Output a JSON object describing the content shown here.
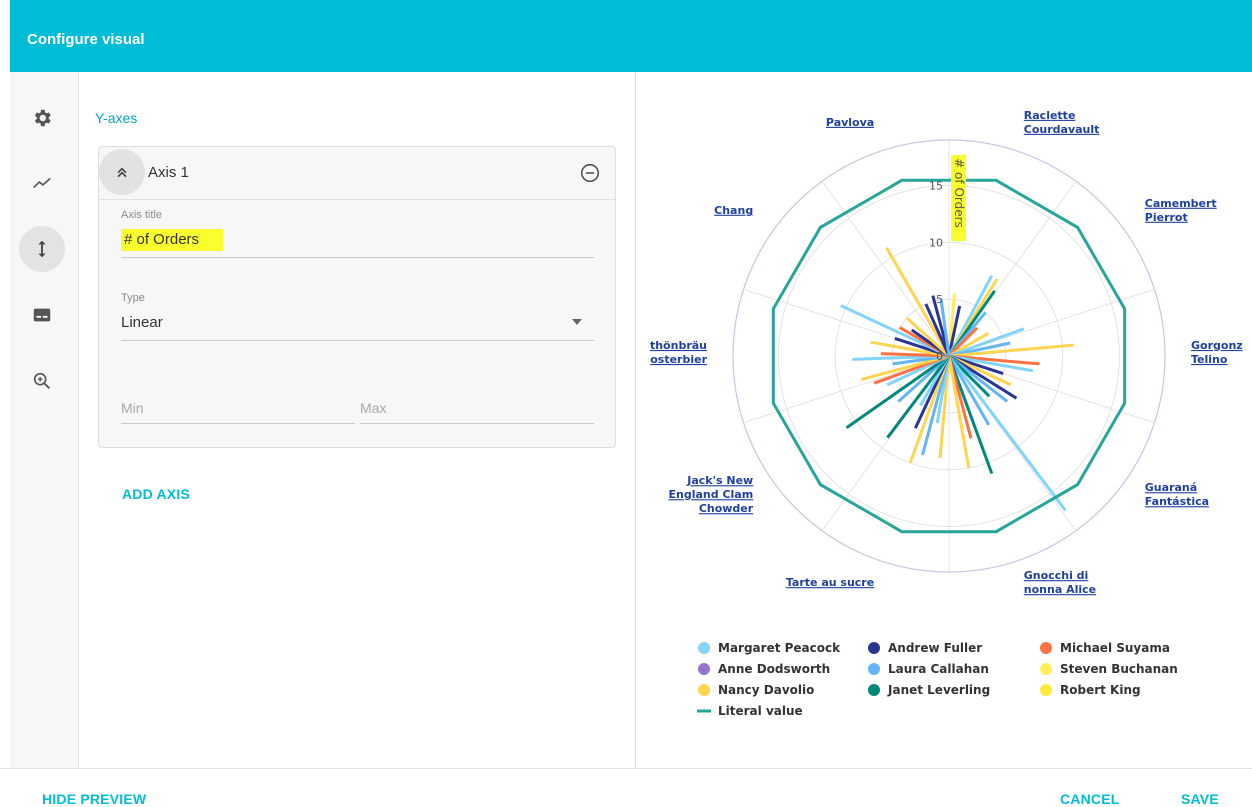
{
  "header": {
    "title": "Configure visual"
  },
  "sidebar_icons": [
    {
      "name": "gear-icon",
      "active": false
    },
    {
      "name": "line-chart-icon",
      "active": false
    },
    {
      "name": "vertical-arrows-icon",
      "active": true
    },
    {
      "name": "legend-icon",
      "active": false
    },
    {
      "name": "zoom-in-icon",
      "active": false
    }
  ],
  "settings": {
    "section_title": "Y-axes",
    "axis": {
      "name": "Axis 1",
      "title_label": "Axis title",
      "title_value": "# of Orders",
      "type_label": "Type",
      "type_value": "Linear",
      "min_placeholder": "Min",
      "max_placeholder": "Max"
    },
    "add_axis_label": "ADD AXIS"
  },
  "footer": {
    "hide_preview": "HIDE PREVIEW",
    "cancel": "CANCEL",
    "save": "SAVE"
  },
  "colors": {
    "accent": "#00bcd4",
    "highlight": "#f8ff2c",
    "literal_line": "#26a69a"
  },
  "chart_data": {
    "type": "polar",
    "axis_title": "# of Orders",
    "rmax": 19,
    "ticks": [
      0,
      5,
      10,
      15
    ],
    "categories": [
      [
        "Raclette",
        "Courdavault"
      ],
      [
        "Camembert",
        "Pierrot"
      ],
      [
        "Gorgonz",
        "Telino"
      ],
      [
        "Guaraná",
        "Fantástica"
      ],
      [
        "Gnocchi di",
        "nonna Alice"
      ],
      [
        "Tarte au sucre"
      ],
      [
        "Jack's New",
        "England Clam",
        "Chowder"
      ],
      [
        "thönbräu",
        "osterbier"
      ],
      [
        "Chang"
      ],
      [
        "Pavlova"
      ]
    ],
    "literal_value": 16,
    "series": [
      {
        "name": "Margaret Peacock",
        "color": "#81d4fa"
      },
      {
        "name": "Andrew Fuller",
        "color": "#283593"
      },
      {
        "name": "Michael Suyama",
        "color": "#ff7043"
      },
      {
        "name": "Anne Dodsworth",
        "color": "#9575cd"
      },
      {
        "name": "Laura Callahan",
        "color": "#64b5f6"
      },
      {
        "name": "Steven Buchanan",
        "color": "#ffee58"
      },
      {
        "name": "Nancy Davolio",
        "color": "#ffd54f"
      },
      {
        "name": "Janet Leverling",
        "color": "#00897b"
      },
      {
        "name": "Robert King",
        "color": "#ffeb3b"
      }
    ],
    "literal_series": {
      "name": "Literal value",
      "color": "#26a69a"
    },
    "rays": [
      {
        "angle": 5,
        "value": 5.5,
        "series": 5
      },
      {
        "angle": 12,
        "value": 4.5,
        "series": 1
      },
      {
        "angle": 28,
        "value": 8,
        "series": 0
      },
      {
        "angle": 32,
        "value": 8,
        "series": 6
      },
      {
        "angle": 35,
        "value": 7,
        "series": 7
      },
      {
        "angle": 40,
        "value": 5,
        "series": 4
      },
      {
        "angle": 45,
        "value": 3.5,
        "series": 2
      },
      {
        "angle": 60,
        "value": 4,
        "series": 6
      },
      {
        "angle": 70,
        "value": 7,
        "series": 0
      },
      {
        "angle": 78,
        "value": 5.5,
        "series": 4
      },
      {
        "angle": 85,
        "value": 11,
        "series": 6
      },
      {
        "angle": 95,
        "value": 8,
        "series": 2
      },
      {
        "angle": 100,
        "value": 7.5,
        "series": 0
      },
      {
        "angle": 108,
        "value": 5,
        "series": 1
      },
      {
        "angle": 115,
        "value": 6,
        "series": 6
      },
      {
        "angle": 122,
        "value": 7,
        "series": 1
      },
      {
        "angle": 128,
        "value": 6.5,
        "series": 4
      },
      {
        "angle": 135,
        "value": 5,
        "series": 7
      },
      {
        "angle": 143,
        "value": 17,
        "series": 0
      },
      {
        "angle": 150,
        "value": 7,
        "series": 4
      },
      {
        "angle": 160,
        "value": 11,
        "series": 7
      },
      {
        "angle": 165,
        "value": 7.5,
        "series": 2
      },
      {
        "angle": 170,
        "value": 10,
        "series": 6
      },
      {
        "angle": 185,
        "value": 9,
        "series": 6
      },
      {
        "angle": 190,
        "value": 6,
        "series": 0
      },
      {
        "angle": 195,
        "value": 9,
        "series": 4
      },
      {
        "angle": 200,
        "value": 10,
        "series": 6
      },
      {
        "angle": 205,
        "value": 7,
        "series": 1
      },
      {
        "angle": 210,
        "value": 5,
        "series": 0
      },
      {
        "angle": 217,
        "value": 9,
        "series": 7
      },
      {
        "angle": 228,
        "value": 6,
        "series": 4
      },
      {
        "angle": 235,
        "value": 11,
        "series": 7
      },
      {
        "angle": 245,
        "value": 6,
        "series": 0
      },
      {
        "angle": 250,
        "value": 7,
        "series": 2
      },
      {
        "angle": 255,
        "value": 8,
        "series": 6
      },
      {
        "angle": 262,
        "value": 5,
        "series": 4
      },
      {
        "angle": 268,
        "value": 8.5,
        "series": 0
      },
      {
        "angle": 272,
        "value": 6,
        "series": 2
      },
      {
        "angle": 280,
        "value": 7,
        "series": 6
      },
      {
        "angle": 288,
        "value": 5,
        "series": 1
      },
      {
        "angle": 295,
        "value": 10.5,
        "series": 0
      },
      {
        "angle": 300,
        "value": 5,
        "series": 2
      },
      {
        "angle": 305,
        "value": 4,
        "series": 1
      },
      {
        "angle": 312,
        "value": 5,
        "series": 6
      },
      {
        "angle": 330,
        "value": 11,
        "series": 6
      },
      {
        "angle": 336,
        "value": 5,
        "series": 1
      },
      {
        "angle": 345,
        "value": 5.5,
        "series": 1
      },
      {
        "angle": 352,
        "value": 5,
        "series": 4
      }
    ]
  }
}
